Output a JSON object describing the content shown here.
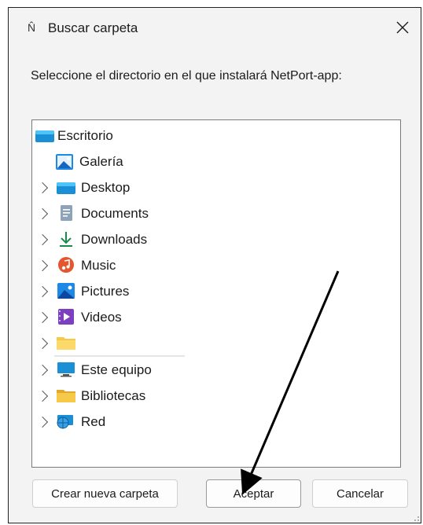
{
  "window": {
    "title": "Buscar carpeta",
    "close_glyph": "✕",
    "app_icon": "N̂"
  },
  "prompt": "Seleccione el directorio en el que instalará NetPort-app:",
  "tree": [
    {
      "label": "Escritorio",
      "icon": "desktop-icon",
      "expandable": false
    },
    {
      "label": "Galería",
      "icon": "gallery-icon",
      "expandable": false
    },
    {
      "label": "Desktop",
      "icon": "desktop-folder-icon",
      "expandable": true
    },
    {
      "label": "Documents",
      "icon": "documents-icon",
      "expandable": true
    },
    {
      "label": "Downloads",
      "icon": "download-icon",
      "expandable": true
    },
    {
      "label": "Music",
      "icon": "music-icon",
      "expandable": true
    },
    {
      "label": "Pictures",
      "icon": "pictures-icon",
      "expandable": true,
      "hovered": true
    },
    {
      "label": "Videos",
      "icon": "videos-icon",
      "expandable": true
    },
    {
      "label": "",
      "icon": "folder-icon",
      "expandable": true
    },
    {
      "label": "Este equipo",
      "icon": "computer-icon",
      "expandable": true
    },
    {
      "label": "Bibliotecas",
      "icon": "libraries-icon",
      "expandable": true
    },
    {
      "label": "Red",
      "icon": "network-icon",
      "expandable": true
    }
  ],
  "buttons": {
    "new_folder": "Crear nueva carpeta",
    "accept": "Aceptar",
    "cancel": "Cancelar"
  },
  "annotation": {
    "arrow_color": "#000000",
    "arrow_points_to": "accept-button"
  }
}
